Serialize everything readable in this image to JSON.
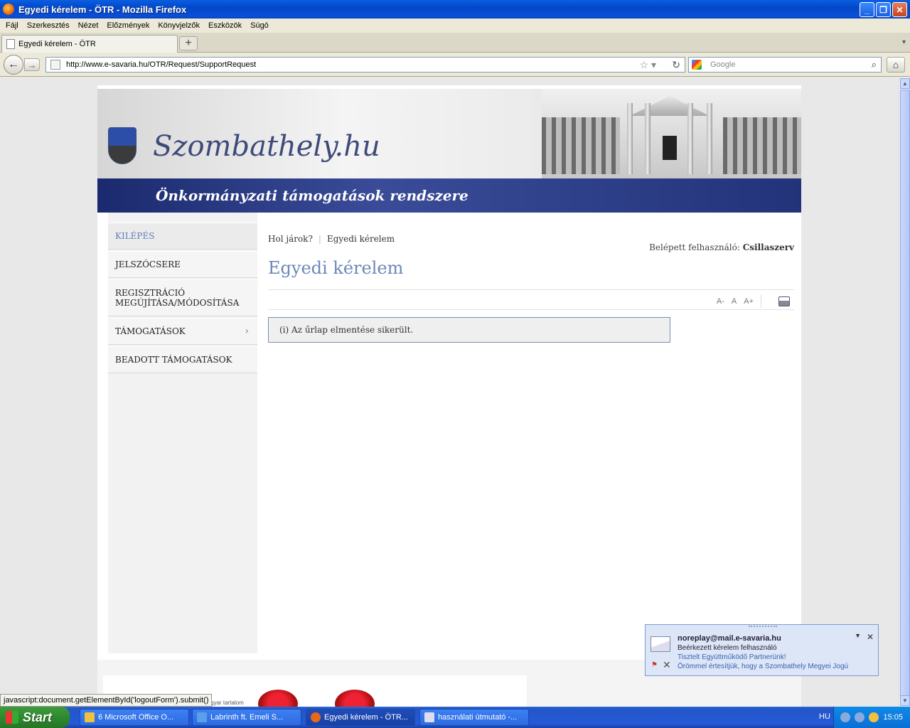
{
  "window": {
    "title": "Egyedi kérelem - ÖTR - Mozilla Firefox"
  },
  "menu": [
    "Fájl",
    "Szerkesztés",
    "Nézet",
    "Előzmények",
    "Könyvjelzők",
    "Eszközök",
    "Súgó"
  ],
  "tab": {
    "label": "Egyedi kérelem - ÖTR"
  },
  "nav": {
    "url": "http://www.e-savaria.hu/OTR/Request/SupportRequest",
    "search_placeholder": "Google"
  },
  "site": {
    "logo_text": "Szombathely.hu",
    "subtitle": "Önkormányzati támogatások rendszere"
  },
  "sidebar": {
    "items": [
      {
        "label": "KILÉPÉS"
      },
      {
        "label": "JELSZÓCSERE"
      },
      {
        "label": "REGISZTRÁCIÓ MEGÚJÍTÁSA/MÓDOSÍTÁSA"
      },
      {
        "label": "TÁMOGATÁSOK"
      },
      {
        "label": "BEADOTT TÁMOGATÁSOK"
      }
    ]
  },
  "main": {
    "breadcrumb": {
      "prefix": "Hol járok?",
      "current": "Egyedi kérelem"
    },
    "user_label": "Belépett felhasználó:",
    "user_name": "Csillaszerv",
    "title": "Egyedi kérelem",
    "font_tools": [
      "A-",
      "A",
      "A+"
    ],
    "message": "(i) Az űrlap elmentése sikerült."
  },
  "footer": {
    "label": "magyar tartalom"
  },
  "status": {
    "text": "javascript:document.getElementById('logoutForm').submit()"
  },
  "notification": {
    "from": "noreplay@mail.e-savaria.hu",
    "subject": "Beérkezett kérelem felhasználó",
    "line1": "Tisztelt Együttműködő Partnerünk!",
    "line2": "Örömmel értesítjük, hogy a Szombathely Megyei Jogú"
  },
  "taskbar": {
    "start": "Start",
    "items": [
      "6 Microsoft Office O...",
      "Labrinth ft. Emeli S...",
      "Egyedi kérelem - ÖTR...",
      "használati útmutató -..."
    ],
    "lang": "HU",
    "clock": "15:05"
  }
}
